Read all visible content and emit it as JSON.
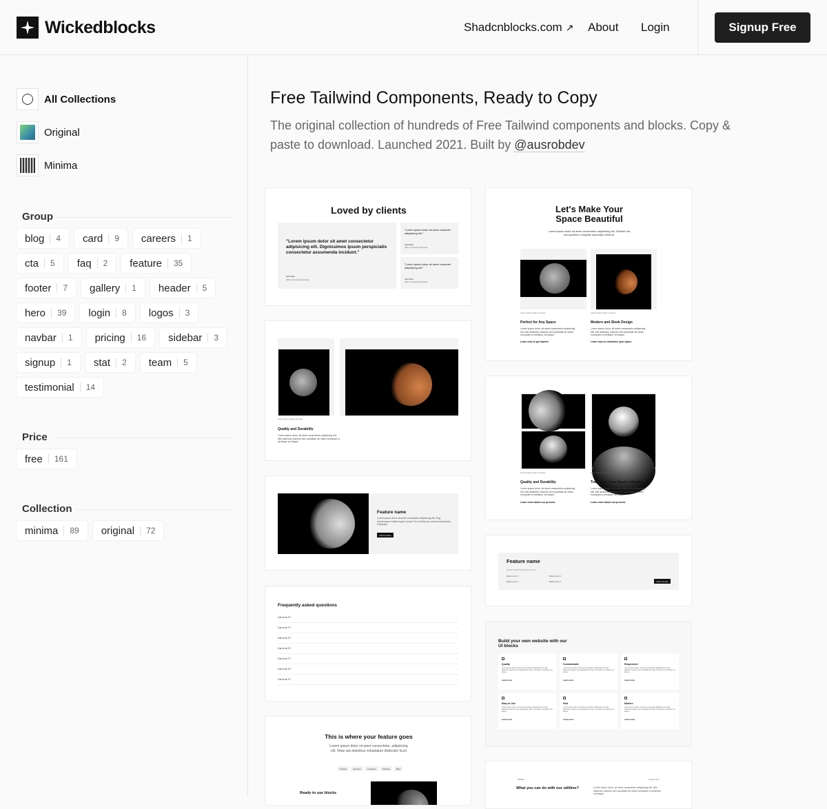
{
  "brand": {
    "name": "Wickedblocks"
  },
  "nav": {
    "shadcn": "Shadcnblocks.com",
    "shadcn_arrow": "↗",
    "about": "About",
    "login": "Login",
    "signup": "Signup Free"
  },
  "collections": [
    {
      "label": "All Collections"
    },
    {
      "label": "Original"
    },
    {
      "label": "Minima"
    }
  ],
  "groups": {
    "title": "Group",
    "items": [
      {
        "label": "blog",
        "count": "4"
      },
      {
        "label": "card",
        "count": "9"
      },
      {
        "label": "careers",
        "count": "1"
      },
      {
        "label": "cta",
        "count": "5"
      },
      {
        "label": "faq",
        "count": "2"
      },
      {
        "label": "feature",
        "count": "35"
      },
      {
        "label": "footer",
        "count": "7"
      },
      {
        "label": "gallery",
        "count": "1"
      },
      {
        "label": "header",
        "count": "5"
      },
      {
        "label": "hero",
        "count": "39"
      },
      {
        "label": "login",
        "count": "8"
      },
      {
        "label": "logos",
        "count": "3"
      },
      {
        "label": "navbar",
        "count": "1"
      },
      {
        "label": "pricing",
        "count": "16"
      },
      {
        "label": "sidebar",
        "count": "3"
      },
      {
        "label": "signup",
        "count": "1"
      },
      {
        "label": "stat",
        "count": "2"
      },
      {
        "label": "team",
        "count": "5"
      },
      {
        "label": "testimonial",
        "count": "14"
      }
    ]
  },
  "price": {
    "title": "Price",
    "items": [
      {
        "label": "free",
        "count": "161"
      }
    ]
  },
  "collection": {
    "title": "Collection",
    "items": [
      {
        "label": "minima",
        "count": "89"
      },
      {
        "label": "original",
        "count": "72"
      }
    ]
  },
  "main": {
    "title": "Free Tailwind Components, Ready to Copy",
    "subtitle": "The original collection of hundreds of Free Tailwind components and blocks. Copy & paste to download. Launched 2021. Built by",
    "author": "@ausrobdev"
  },
  "previews": {
    "testimonial_title": "Loved by clients",
    "testimonial_quote": "\"Lorem ipsum dolor sit amet consectetur adipisicing elit. Dignissimos ipsum perspiciatis consectetur assumenda incidunt.\"",
    "testimonial_small": "\"Lorem ipsum dolor sit amet consecte adipisicing elit.\"",
    "testimonial_name": "John Doe",
    "testimonial_role": "CEO, Company Example",
    "space_title": "Let's Make Your Space Beautiful",
    "space_sub": "Lorem ipsum dolor sit amet consectetur adipisicing elit. Deleniti nisi accusantium voluptate asperiatur minima.",
    "space_col1": "Perfect for Any Space",
    "space_col2": "Modern and Sleek Design",
    "space_link1": "Learn how to get started",
    "space_link2": "Learn how to customize your space",
    "caption": "Lorem ipsum dolor sit amet",
    "body_text": "Lorem ipsum dolor, sit amet consectetur adipisicing elit. Nisi distinctio maiores sint cupiditate ab ullam numquam a similique vel itaque.",
    "quality": "Quality and Durability",
    "transform": "Transform Your Space a Reality",
    "learn_more": "Learn more about our process",
    "feature_name": "Feature name",
    "feature_body": "Lorem ipsum dolor sit amet consectetur adipisicing elit. Elig doloremque mollitia fugiat omnis! Porro facilis quo animi consequatur. Explicabo.",
    "call_to_action": "Call to Action",
    "bullet_heading": "BULLET POINTS & INTRODUCTION",
    "bullet_point": "Bullet point 1",
    "faq_title": "Frequently asked questions",
    "faq_items": [
      "Can it do X?",
      "Can it do Y?",
      "Can it do Z?",
      "Can it do X?",
      "Can it do Y?",
      "Can it do Z?",
      "Can it do X?"
    ],
    "build_title": "Build your own website with our UI blocks",
    "build_items": [
      "Quality",
      "Customizable",
      "Responsive",
      "Easy to Use",
      "Fast",
      "Modern"
    ],
    "learn_more_short": "Learn more",
    "feature_goes": "This is where your feature goes",
    "feature_goes_sub": "Lorem ipsum dolor sit amet consectetur, adipisicing elit. Vitae aut doloribus voluptatum distinctio! Eum",
    "tabs": [
      "Product",
      "Services",
      "Company",
      "Portfolio",
      "Blog"
    ],
    "ready_blocks": "Ready to use blocks",
    "utilities_title": "What you can do with our utilities?",
    "utilities_brand": "Utilities",
    "utilities_learn": "Learn more"
  }
}
